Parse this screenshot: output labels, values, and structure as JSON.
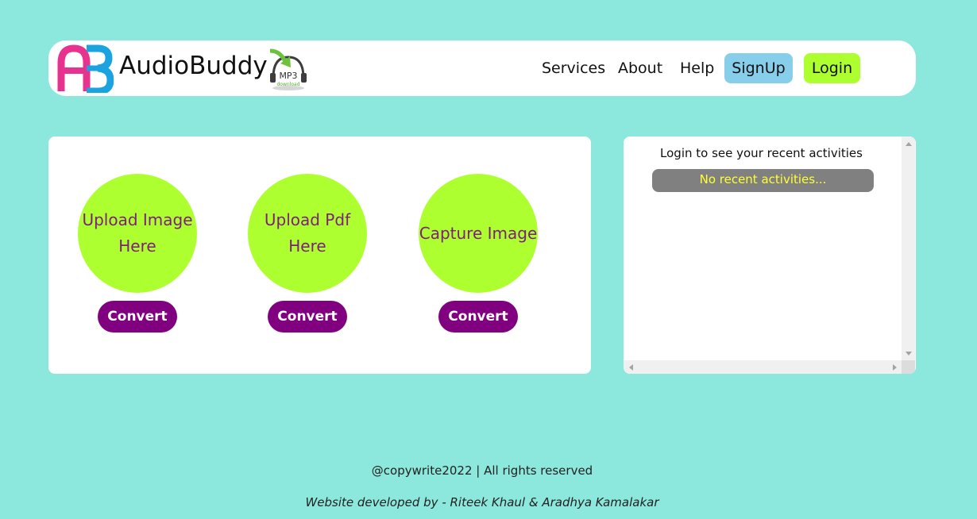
{
  "header": {
    "brand_name": "AudioBuddy",
    "logo_letters": "AB",
    "mp3_badge": "MP3",
    "mp3_caption": "download",
    "nav": {
      "services": "Services",
      "about": "About",
      "help": "Help"
    },
    "signup_label": "SignUp",
    "login_label": "Login"
  },
  "main": {
    "cards": [
      {
        "line1": "Upload Image",
        "line2": "Here",
        "button": "Convert"
      },
      {
        "line1": "Upload Pdf",
        "line2": "Here",
        "button": "Convert"
      },
      {
        "line1": "Capture Image",
        "line2": "",
        "button": "Convert"
      }
    ]
  },
  "sidebar": {
    "heading": "Login to see your recent activities",
    "empty_message": "No recent activities..."
  },
  "footer": {
    "copyright": "@copywrite2022 | All rights reserved",
    "credits": "Website developed by - Riteek Khaul & Aradhya Kamalakar"
  },
  "colors": {
    "background": "#8ce7dc",
    "accent_green": "#adff2f",
    "accent_purple": "#800080",
    "signup_blue": "#87ceeb",
    "logo_pink": "#e8328f",
    "logo_blue": "#1aa3e0"
  }
}
